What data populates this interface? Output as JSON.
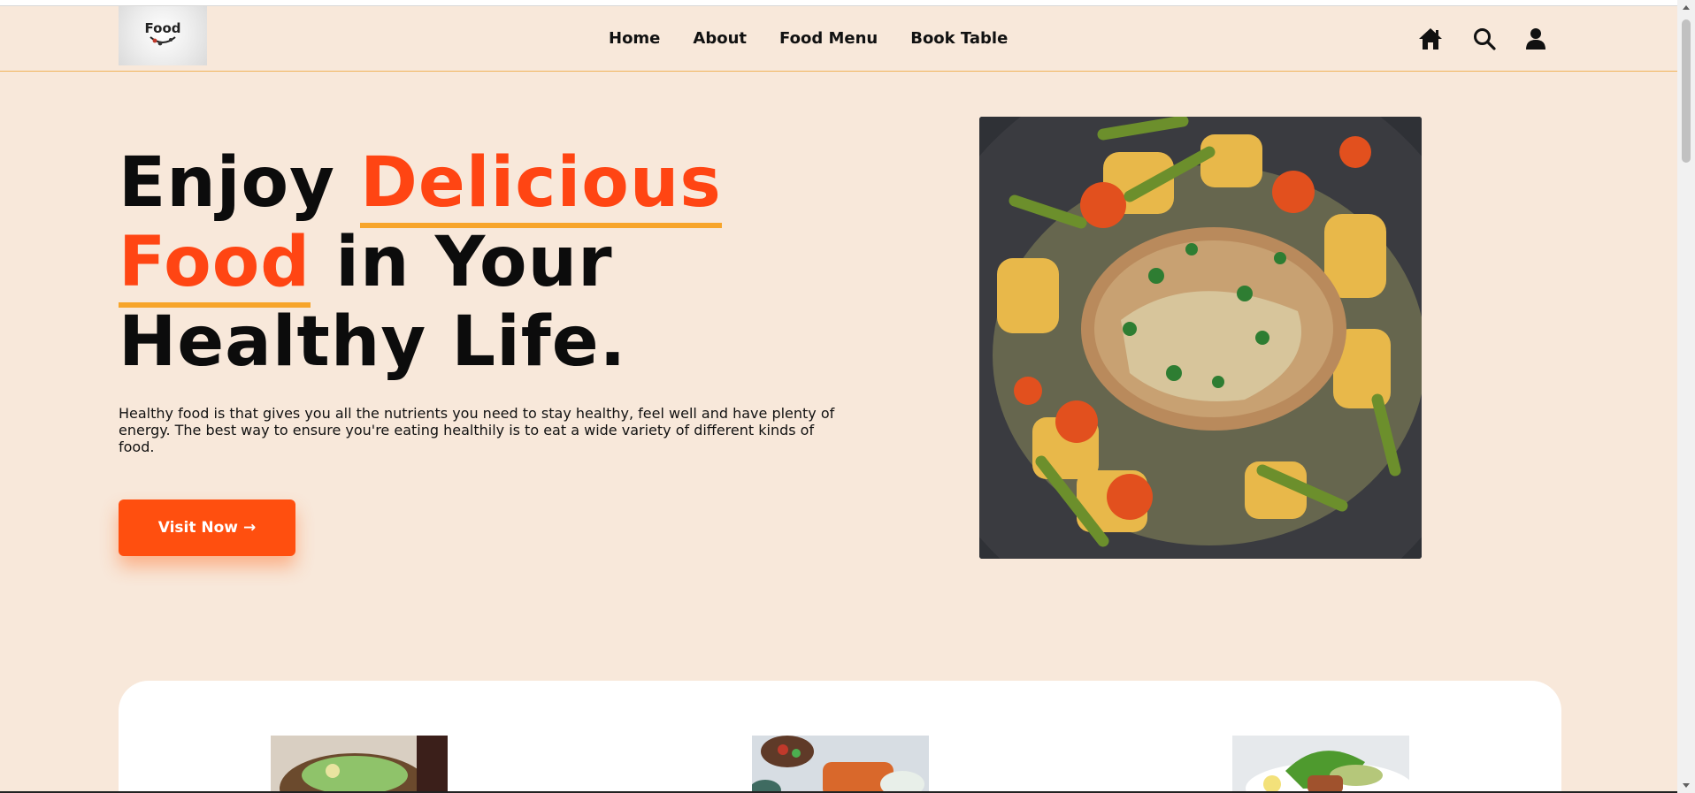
{
  "logo": {
    "text": "Food"
  },
  "nav": {
    "links": [
      "Home",
      "About",
      "Food Menu",
      "Book Table"
    ],
    "icons": [
      "home-icon",
      "search-icon",
      "user-icon"
    ]
  },
  "hero": {
    "title_line1_plain": "Enjoy ",
    "title_line1_highlight": "Delicious",
    "title_line2_highlight": "Food",
    "title_line2_plain": " in Your",
    "title_line3": "Healthy Life.",
    "description": "Healthy food is that gives you all the nutrients you need to stay healthy, feel well and have plenty of energy. The best way to ensure you're eating healthily is to eat a wide variety of different kinds of food.",
    "cta_label": "Visit Now",
    "cta_arrow": "→"
  },
  "colors": {
    "background": "#f8e8da",
    "accent": "#ff4513",
    "underline": "#f7a52b",
    "button": "#ff4f0f"
  }
}
